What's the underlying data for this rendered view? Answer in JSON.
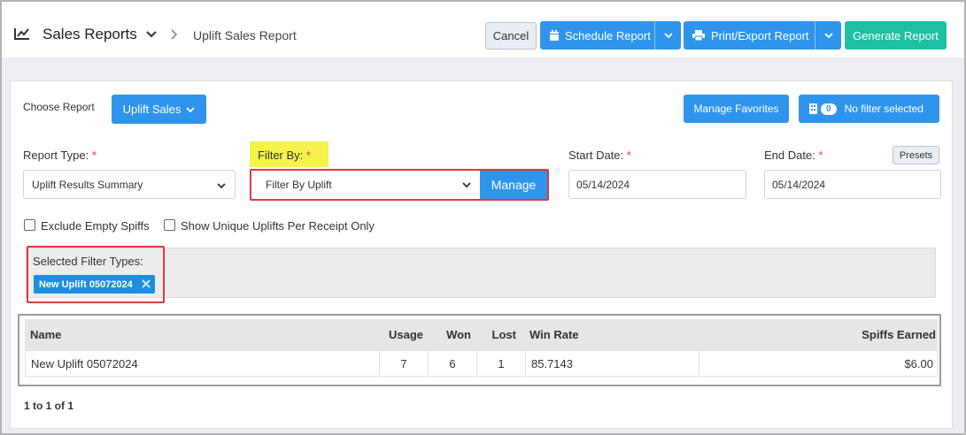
{
  "header": {
    "title": "Sales Reports",
    "breadcrumb_current": "Uplift Sales Report",
    "cancel_label": "Cancel",
    "schedule_label": "Schedule Report",
    "print_label": "Print/Export Report",
    "generate_label": "Generate Report"
  },
  "report_bar": {
    "choose_label": "Choose Report",
    "report_button": "Uplift Sales",
    "favorites_label": "Manage Favorites",
    "filter_count": "0",
    "filter_status": "No filter selected"
  },
  "form": {
    "report_type_label": "Report Type:",
    "report_type_value": "Uplift Results Summary",
    "filter_by_label": "Filter By:",
    "filter_by_value": "Filter By Uplift",
    "manage_label": "Manage",
    "start_date_label": "Start Date:",
    "start_date_value": "05/14/2024",
    "end_date_label": "End Date:",
    "end_date_value": "05/14/2024",
    "presets_label": "Presets",
    "required_mark": "*",
    "exclude_empty_label": "Exclude Empty Spiffs",
    "unique_uplifts_label": "Show Unique Uplifts Per Receipt Only"
  },
  "filters": {
    "selected_label": "Selected Filter Types:",
    "chips": [
      "New Uplift 05072024"
    ]
  },
  "table": {
    "headers": [
      "Name",
      "Usage",
      "Won",
      "Lost",
      "Win Rate",
      "Spiffs Earned"
    ],
    "rows": [
      [
        "New Uplift 05072024",
        "7",
        "6",
        "1",
        "85.7143",
        "$6.00"
      ]
    ]
  },
  "pagination": "1 to 1 of 1",
  "colors": {
    "primary": "#2f95ec",
    "teal": "#1fbfa3",
    "highlight": "#f4f34a",
    "annotation_red": "#e0393e"
  }
}
